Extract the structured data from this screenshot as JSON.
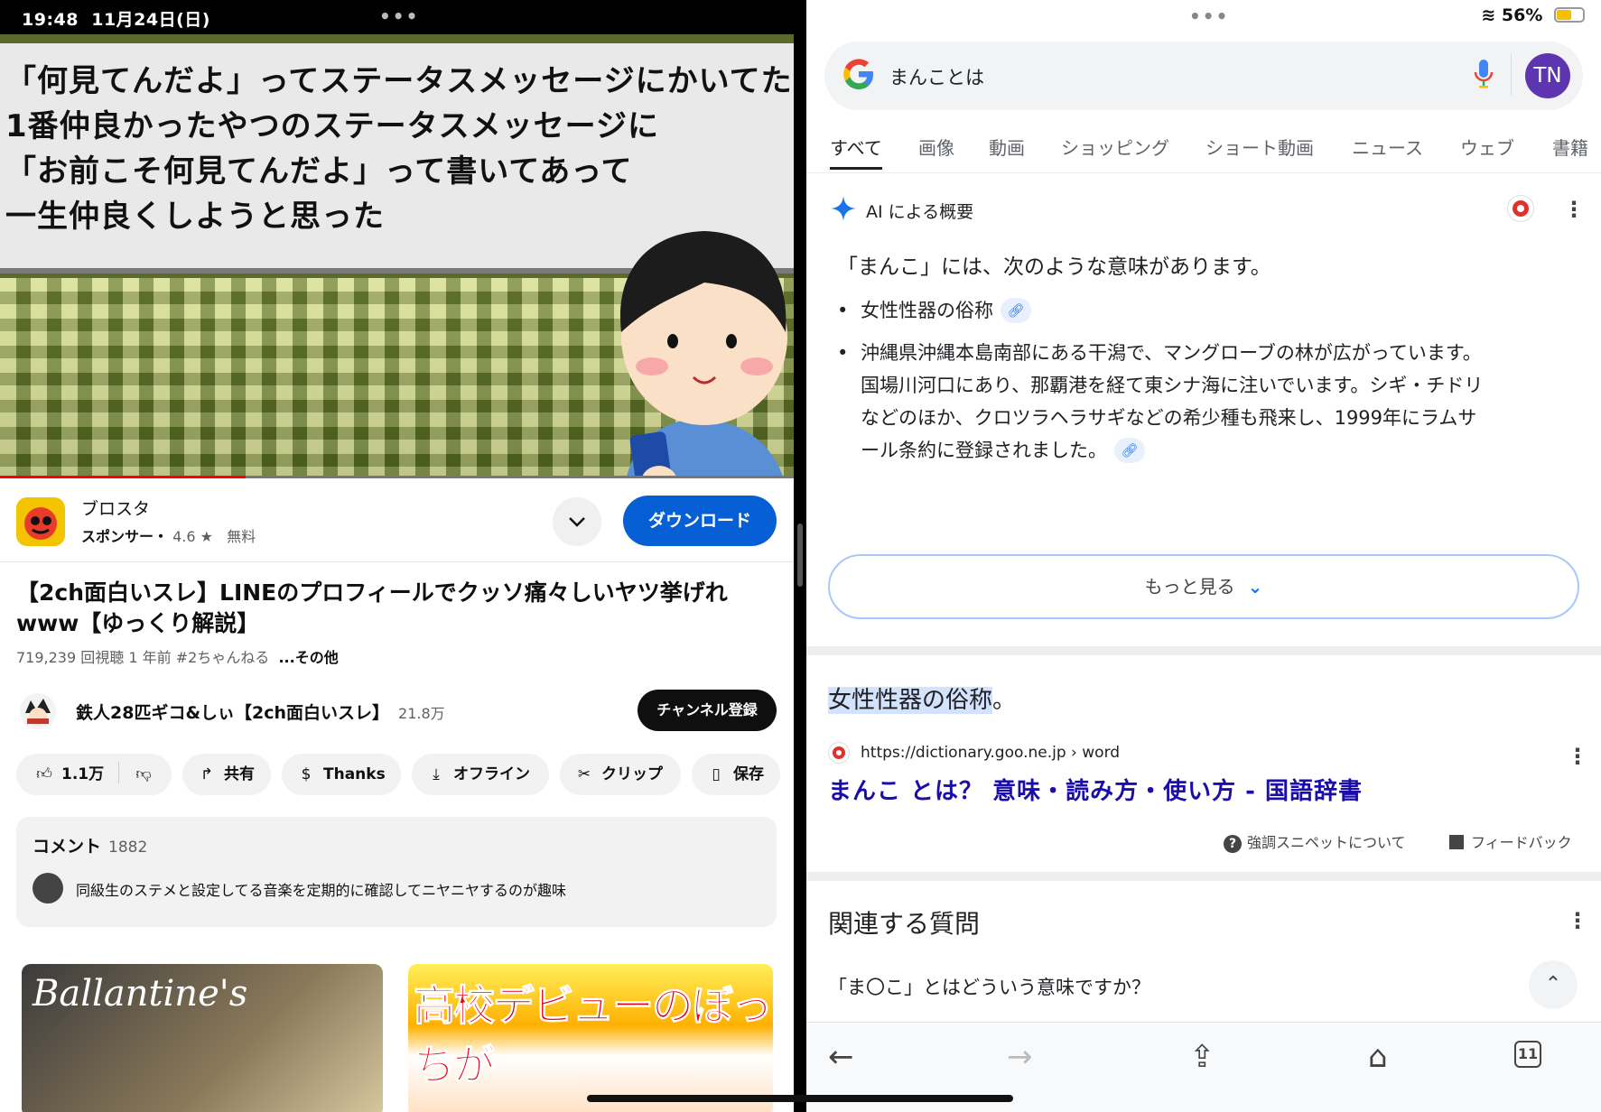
{
  "status": {
    "time": "19:48",
    "date": "11月24日(日)",
    "multitask_dots": "•••",
    "battery_text": "56%",
    "battery_level": 0.56
  },
  "youtube": {
    "video": {
      "caption_lines": [
        "「何見てんだよ」ってステータスメッセージにかいてたら",
        "1番仲良かったやつのステータスメッセージに",
        "「お前こそ何見てんだよ」って書いてあって",
        "一生仲良くしようと思った"
      ],
      "progress": 0.31
    },
    "ad": {
      "name": "ブロスタ",
      "sponsor": "スポンサー・",
      "rating": "4.6 ★",
      "price": "無料",
      "download_label": "ダウンロード"
    },
    "title": "【2ch面白いスレ】LINEのプロフィールでクッソ痛々しいヤツ挙げれwww【ゆっくり解説】",
    "meta": "719,239 回視聴  1 年前  #2ちゃんねる",
    "meta_more": "...その他",
    "channel": {
      "name": "鉄人28匹ギコ&しぃ【2ch面白いスレ】",
      "subs": "21.8万",
      "subscribe_label": "チャンネル登録"
    },
    "actions": {
      "like_count": "1.1万",
      "share": "共有",
      "thanks": "Thanks",
      "offline": "オフライン",
      "clip": "クリップ",
      "save": "保存"
    },
    "comments": {
      "label": "コメント",
      "count": "1882",
      "top_comment": "同級生のステメと設定してる音楽を定期的に確認してニヤニヤするのが趣味"
    },
    "thumbs": {
      "thumb1_text": "Ballantine's",
      "thumb2_text": "高校デビューのぼっちが"
    }
  },
  "google": {
    "query": "まんことは",
    "avatar_initials": "TN",
    "tabs": [
      "すべて",
      "画像",
      "動画",
      "ショッピング",
      "ショート動画",
      "ニュース",
      "ウェブ",
      "書籍"
    ],
    "active_tab": "すべて",
    "ai": {
      "heading": "AI による概要",
      "lead": "「まんこ」には、次のような意味があります。",
      "bullet1": "女性性器の俗称",
      "bullet2_lines": [
        "沖縄県沖縄本島南部にある干潟で、マングローブの林が広がっています。",
        "国場川河口にあり、那覇港を経て東シナ海に注いでいます。シギ・チドリ",
        "などのほか、クロツラヘラサギなどの希少種も飛来し、1999年にラムサ",
        "ール条約に登録されました。"
      ],
      "more_label": "もっと見る"
    },
    "snippet": {
      "highlight": "女性性器の俗称",
      "tail": "。",
      "source_url": "https://dictionary.goo.ne.jp › word",
      "source_title": "まんこ とは？ 意味・読み方・使い方 - 国語辞書",
      "about_label": "強調スニペットについて",
      "feedback_label": "フィードバック"
    },
    "related": {
      "heading": "関連する質問",
      "q1": "「ま〇こ」とはどういう意味ですか？"
    },
    "toolbar": {
      "tabs_count": "11"
    }
  },
  "colors": {
    "yt_blue": "#065fd4",
    "yt_red": "#ff0000",
    "g_link": "#1a0dab",
    "g_blue": "#1a73e8",
    "avatar_purple": "#5e35b1"
  },
  "icons": [
    "chevron-down-icon",
    "thumbs-up-icon",
    "thumbs-down-icon",
    "share-icon",
    "thanks-icon",
    "download-icon",
    "scissors-icon",
    "bookmark-icon",
    "google-logo-icon",
    "mic-icon",
    "sparkle-icon",
    "link-icon",
    "kebab-icon",
    "help-icon",
    "flag-icon",
    "back-icon",
    "forward-icon",
    "share-up-icon",
    "home-icon",
    "tabs-icon",
    "chevron-up-icon",
    "wifi-icon",
    "battery-icon"
  ]
}
